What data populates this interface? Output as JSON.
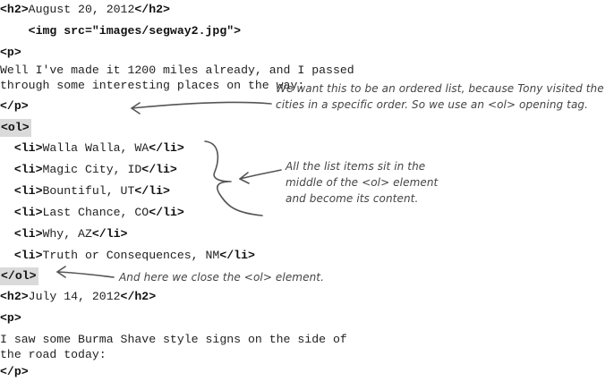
{
  "code_lines": [
    {
      "id": "h2-open-1",
      "tag_open": "<h2>",
      "text": "August 20, 2012",
      "tag_close": "</h2>"
    },
    {
      "id": "img",
      "indent": "    ",
      "tag_open": "<img src=\"images/segway2.jpg\">"
    },
    {
      "id": "p-open-1",
      "tag_open": "<p>"
    },
    {
      "id": "text-1a",
      "text": "Well I've made it 1200 miles already, and I passed"
    },
    {
      "id": "text-1b",
      "text": "through some interesting places on the way:"
    },
    {
      "id": "p-close-1",
      "tag_open": "</p>"
    },
    {
      "id": "ol-open",
      "tag_open": "<ol>",
      "highlight": true
    },
    {
      "id": "li-1",
      "indent": "  ",
      "tag_open": "<li>",
      "text": "Walla Walla, WA",
      "tag_close": "</li>"
    },
    {
      "id": "li-2",
      "indent": "  ",
      "tag_open": "<li>",
      "text": "Magic City, ID",
      "tag_close": "</li>"
    },
    {
      "id": "li-3",
      "indent": "  ",
      "tag_open": "<li>",
      "text": "Bountiful, UT",
      "tag_close": "</li>"
    },
    {
      "id": "li-4",
      "indent": "  ",
      "tag_open": "<li>",
      "text": "Last Chance, CO",
      "tag_close": "</li>"
    },
    {
      "id": "li-5",
      "indent": "  ",
      "tag_open": "<li>",
      "text": "Why, AZ",
      "tag_close": "</li>"
    },
    {
      "id": "li-6",
      "indent": "  ",
      "tag_open": "<li>",
      "text": "Truth or Consequences, NM",
      "tag_close": "</li>"
    },
    {
      "id": "ol-close",
      "tag_open": "</ol>",
      "highlight": true
    },
    {
      "id": "h2-open-2",
      "tag_open": "<h2>",
      "text": "July 14, 2012",
      "tag_close": "</h2>"
    },
    {
      "id": "p-open-2",
      "tag_open": "<p>"
    },
    {
      "id": "text-2a",
      "text": "I saw some Burma Shave style signs on the side of"
    },
    {
      "id": "text-2b",
      "text": "the road today:"
    },
    {
      "id": "p-close-2",
      "tag_open": "</p>"
    }
  ],
  "annotations": {
    "ordered_list_note": {
      "line1": "We want this to be an ordered list, because Tony visited the",
      "line2": "cities in a specific order. So we use an <ol> opening tag."
    },
    "list_items_note": {
      "line1": "All the list items sit in the",
      "line2": "middle of the <ol> element",
      "line3": "and become its content."
    },
    "close_note": {
      "line1": "And here we close the <ol> element."
    }
  },
  "colors": {
    "highlight": "#dadada",
    "annotation": "#444444",
    "code": "#222222"
  }
}
